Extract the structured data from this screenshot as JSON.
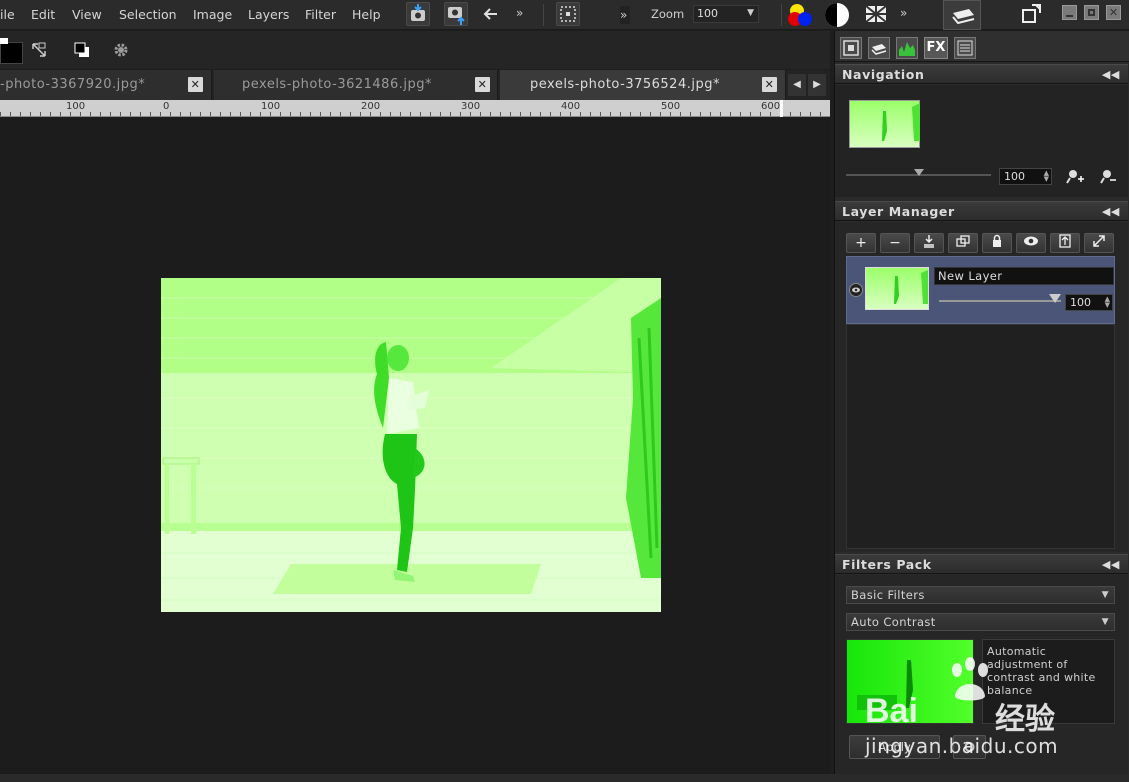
{
  "menubar": {
    "items": [
      "ile",
      "Edit",
      "View",
      "Selection",
      "Image",
      "Layers",
      "Filter",
      "Help"
    ],
    "more1": "»",
    "more2": "»",
    "more3": "»",
    "zoom_label": "Zoom",
    "zoom_value": "100"
  },
  "tabs": [
    {
      "label": "-photo-3367920.jpg*",
      "active": false
    },
    {
      "label": "pexels-photo-3621486.jpg*",
      "active": false
    },
    {
      "label": "pexels-photo-3756524.jpg*",
      "active": true
    }
  ],
  "tab_close_glyph": "✕",
  "ruler": {
    "labels": [
      "100",
      "0",
      "100",
      "200",
      "300",
      "400",
      "500",
      "600"
    ]
  },
  "navigation": {
    "title": "Navigation",
    "zoom_value": "100"
  },
  "layer_manager": {
    "title": "Layer Manager",
    "layers": [
      {
        "name": "New Layer",
        "opacity": "100"
      }
    ]
  },
  "filters_pack": {
    "title": "Filters Pack",
    "category": "Basic Filters",
    "filter": "Auto Contrast",
    "description": "Automatic adjustment of contrast and white balance",
    "apply_label": "Apply"
  },
  "panel_tabs": {
    "fx_label": "FX"
  },
  "watermark": {
    "brand": "Bai",
    "brand_cn": "经验",
    "url": "jingyan.baidu.com"
  },
  "colors": {
    "accent_selected_layer": "#4a5577",
    "photo_tint": "#aaff7a"
  }
}
